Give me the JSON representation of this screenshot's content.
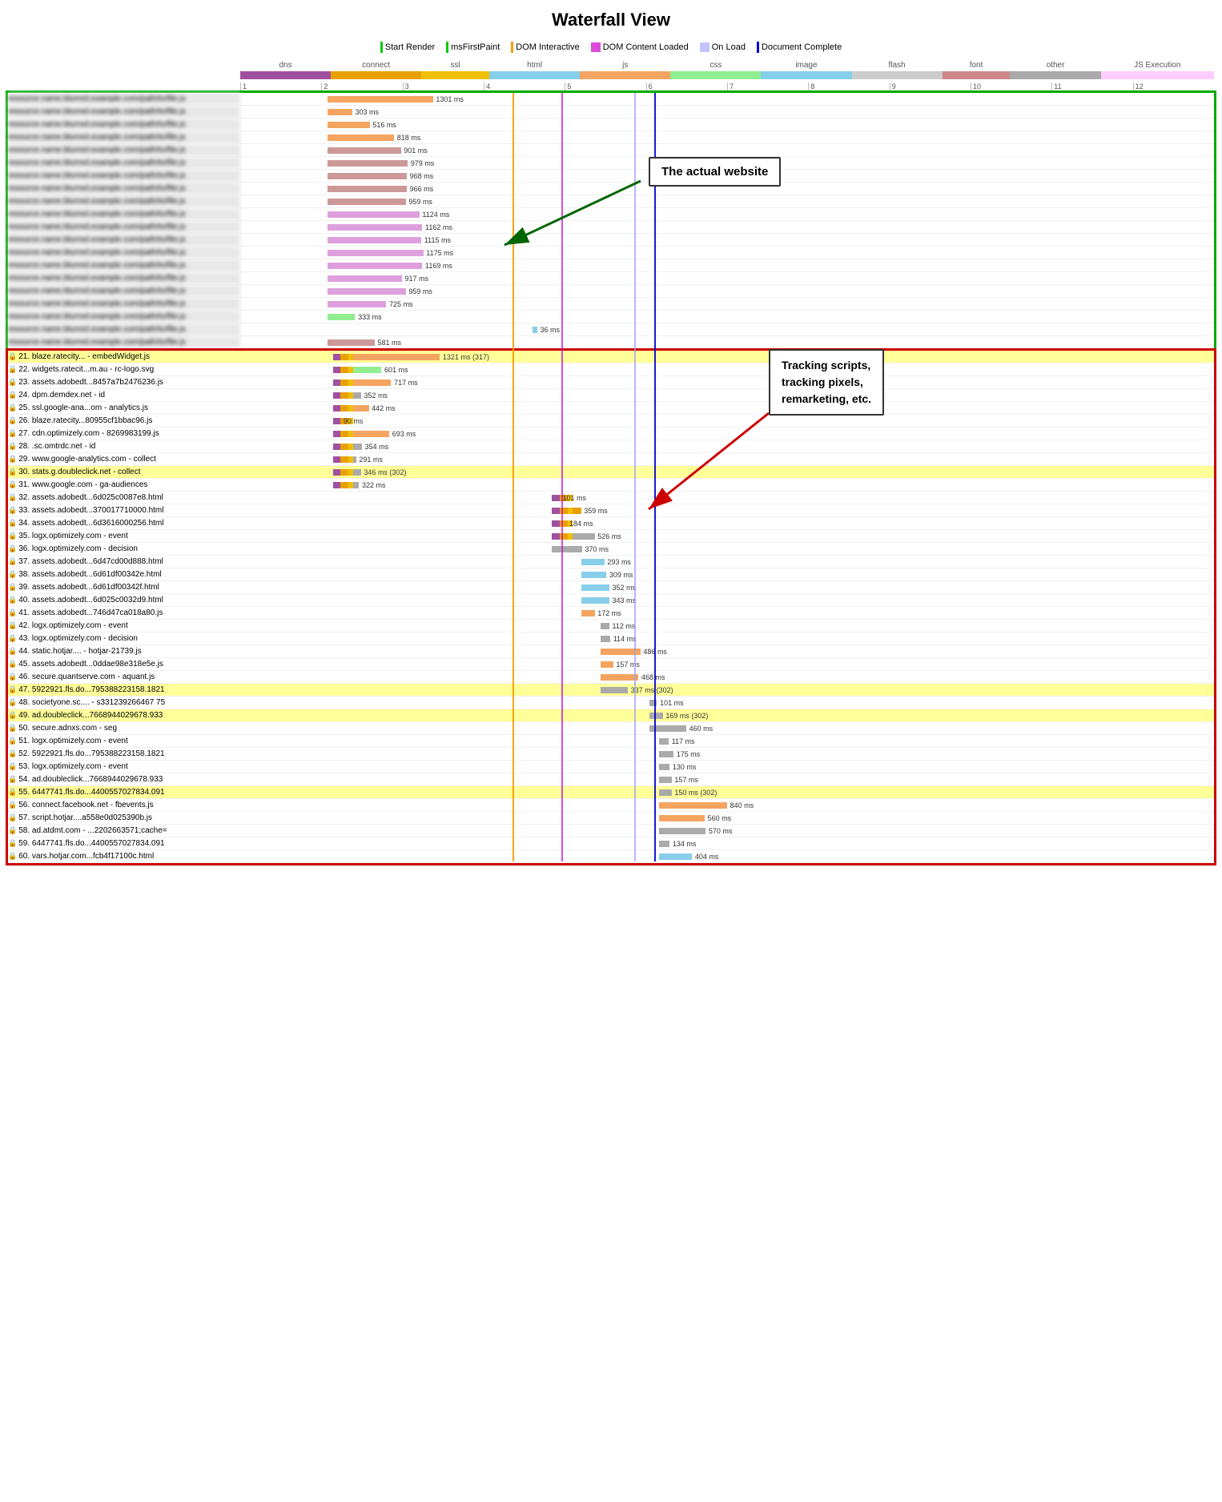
{
  "title": "Waterfall View",
  "legend": {
    "items": [
      {
        "label": "Start Render",
        "type": "line-green"
      },
      {
        "label": "msFirstPaint",
        "type": "line-green"
      },
      {
        "label": "DOM Interactive",
        "type": "line-orange"
      },
      {
        "label": "DOM Content Loaded",
        "type": "box-purple"
      },
      {
        "label": "On Load",
        "type": "box-lightblue"
      },
      {
        "label": "Document Complete",
        "type": "line-blue"
      }
    ]
  },
  "type_labels": [
    "dns",
    "connect",
    "ssl",
    "html",
    "js",
    "css",
    "image",
    "flash",
    "font",
    "other",
    "JS Execution"
  ],
  "type_colors": [
    "#a050a0",
    "#e8a000",
    "#f0c000",
    "#87ceeb",
    "#f4a460",
    "#90ee90",
    "#87ceeb",
    "#cccccc",
    "#cc8888",
    "#aaaaaa",
    "#ffccff"
  ],
  "tick_labels": [
    "1",
    "2",
    "3",
    "4",
    "5",
    "6",
    "7",
    "8",
    "9",
    "10",
    "11",
    "12"
  ],
  "annotations": {
    "actual_website": "The actual website",
    "tracking": "Tracking scripts,\ntracking pixels,\nremarketing, etc."
  },
  "rows": [
    {
      "name": "",
      "highlight": "none",
      "ms": "1301 ms",
      "type": "js"
    },
    {
      "name": "",
      "highlight": "none",
      "ms": "303 ms",
      "type": "js"
    },
    {
      "name": "",
      "highlight": "none",
      "ms": "516 ms",
      "type": "js"
    },
    {
      "name": "",
      "highlight": "none",
      "ms": "818 ms",
      "type": "js"
    },
    {
      "name": "",
      "highlight": "none",
      "ms": "901 ms",
      "type": "js"
    },
    {
      "name": "",
      "highlight": "none",
      "ms": "979 ms",
      "type": "js"
    },
    {
      "name": "",
      "highlight": "none",
      "ms": "968 ms",
      "type": "js"
    },
    {
      "name": "",
      "highlight": "none",
      "ms": "966 ms",
      "type": "js"
    },
    {
      "name": "",
      "highlight": "none",
      "ms": "959 ms",
      "type": "js"
    },
    {
      "name": "",
      "highlight": "none",
      "ms": "1124 ms",
      "type": "js"
    },
    {
      "name": "",
      "highlight": "none",
      "ms": "1162 ms",
      "type": "js"
    },
    {
      "name": "",
      "highlight": "none",
      "ms": "1115 ms",
      "type": "js"
    },
    {
      "name": "",
      "highlight": "none",
      "ms": "1175 ms",
      "type": "js"
    },
    {
      "name": "",
      "highlight": "none",
      "ms": "1169 ms",
      "type": "js"
    },
    {
      "name": "",
      "highlight": "none",
      "ms": "917 ms",
      "type": "js"
    },
    {
      "name": "",
      "highlight": "none",
      "ms": "959 ms",
      "type": "js"
    },
    {
      "name": "",
      "highlight": "none",
      "ms": "725 ms",
      "type": "js"
    },
    {
      "name": "",
      "highlight": "none",
      "ms": "333 ms",
      "type": "css"
    },
    {
      "name": "",
      "highlight": "none",
      "ms": "36 ms",
      "type": "image"
    },
    {
      "name": "",
      "highlight": "none",
      "ms": "581 ms",
      "type": "other"
    },
    {
      "name": "21. blaze.ratecity... - embedWidget.js",
      "highlight": "yellow",
      "ms": "1321 ms (317)",
      "type": "js"
    },
    {
      "name": "22. widgets.ratecit...m.au - rc-logo.svg",
      "highlight": "none",
      "ms": "601 ms",
      "type": "image"
    },
    {
      "name": "23. assets.adobedt...8457a7b2476236.js",
      "highlight": "none",
      "ms": "717 ms",
      "type": "js"
    },
    {
      "name": "24. dpm.demdex.net - id",
      "highlight": "none",
      "ms": "352 ms",
      "type": "other"
    },
    {
      "name": "25. ssl.google-ana...om - analytics.js",
      "highlight": "none",
      "ms": "442 ms",
      "type": "js"
    },
    {
      "name": "26. blaze.ratecity...80955cf1bbac96.js",
      "highlight": "none",
      "ms": "90 ms",
      "type": "js"
    },
    {
      "name": "27. cdn.optimizely.com - 8269983199.js",
      "highlight": "none",
      "ms": "693 ms",
      "type": "js"
    },
    {
      "name": "28.      .sc.omtrdc.net - id",
      "highlight": "none",
      "ms": "354 ms",
      "type": "other"
    },
    {
      "name": "29. www.google-analytics.com - collect",
      "highlight": "none",
      "ms": "291 ms",
      "type": "other"
    },
    {
      "name": "30. stats.g.doubleclick.net - collect",
      "highlight": "yellow2",
      "ms": "346 ms (302)",
      "type": "other"
    },
    {
      "name": "31. www.google.com - ga-audiences",
      "highlight": "none",
      "ms": "322 ms",
      "type": "other"
    },
    {
      "name": "32. assets.adobedt...6d025c0087e8.html",
      "highlight": "none",
      "ms": "101 ms",
      "type": "html"
    },
    {
      "name": "33. assets.adobedt...370017710000.html",
      "highlight": "none",
      "ms": "359 ms",
      "type": "html"
    },
    {
      "name": "34. assets.adobedt...6d3616000256.html",
      "highlight": "none",
      "ms": "184 ms",
      "type": "html"
    },
    {
      "name": "35. logx.optimizely.com - event",
      "highlight": "none",
      "ms": "526 ms",
      "type": "other"
    },
    {
      "name": "36. logx.optimizely.com - decision",
      "highlight": "none",
      "ms": "370 ms",
      "type": "other"
    },
    {
      "name": "37. assets.adobedt...6d47cd00d888.html",
      "highlight": "none",
      "ms": "293 ms",
      "type": "html"
    },
    {
      "name": "38. assets.adobedt...6d61df00342e.html",
      "highlight": "none",
      "ms": "309 ms",
      "type": "html"
    },
    {
      "name": "39. assets.adobedt...6d61df00342f.html",
      "highlight": "none",
      "ms": "352 ms",
      "type": "html"
    },
    {
      "name": "40. assets.adobedt...6d025c0032d9.html",
      "highlight": "none",
      "ms": "343 ms",
      "type": "html"
    },
    {
      "name": "41. assets.adobedt...746d47ca018a80.js",
      "highlight": "none",
      "ms": "172 ms",
      "type": "js"
    },
    {
      "name": "42. logx.optimizely.com - event",
      "highlight": "none",
      "ms": "112 ms",
      "type": "other"
    },
    {
      "name": "43. logx.optimizely.com - decision",
      "highlight": "none",
      "ms": "114 ms",
      "type": "other"
    },
    {
      "name": "44. static.hotjar.... - hotjar-21739.js",
      "highlight": "none",
      "ms": "486 ms",
      "type": "js"
    },
    {
      "name": "45. assets.adobedt...0ddae98e318e5e.js",
      "highlight": "none",
      "ms": "157 ms",
      "type": "js"
    },
    {
      "name": "46. secure.quantserve.com - aquant.js",
      "highlight": "none",
      "ms": "468 ms",
      "type": "js"
    },
    {
      "name": "47. 5922921.fls.do...795388223158.1821",
      "highlight": "yellow2",
      "ms": "337 ms (302)",
      "type": "other"
    },
    {
      "name": "48. societyone.sc.... - s331239266467 75",
      "highlight": "none",
      "ms": "101 ms",
      "type": "other"
    },
    {
      "name": "49. ad.doubleclick...7668944029678.933",
      "highlight": "yellow2",
      "ms": "169 ms (302)",
      "type": "other"
    },
    {
      "name": "50. secure.adnxs.com - seg",
      "highlight": "none",
      "ms": "460 ms",
      "type": "other"
    },
    {
      "name": "51. logx.optimizely.com - event",
      "highlight": "none",
      "ms": "117 ms",
      "type": "other"
    },
    {
      "name": "52. 5922921.fls.do...795388223158.1821",
      "highlight": "none",
      "ms": "175 ms",
      "type": "other"
    },
    {
      "name": "53. logx.optimizely.com - event",
      "highlight": "none",
      "ms": "130 ms",
      "type": "other"
    },
    {
      "name": "54. ad.doubleclick...7668944029678.933",
      "highlight": "none",
      "ms": "157 ms",
      "type": "other"
    },
    {
      "name": "55. 6447741.fls.do...4400557027834.091",
      "highlight": "yellow2",
      "ms": "150 ms (302)",
      "type": "other"
    },
    {
      "name": "56. connect.facebook.net - fbevents.js",
      "highlight": "none",
      "ms": "840 ms",
      "type": "js"
    },
    {
      "name": "57. script.hotjar....a558e0d025390b.js",
      "highlight": "none",
      "ms": "560 ms",
      "type": "js"
    },
    {
      "name": "58. ad.atdmt.com - ...2202663571;cache=",
      "highlight": "none",
      "ms": "570 ms",
      "type": "other"
    },
    {
      "name": "59. 6447741.fls.do...4400557027834.091",
      "highlight": "none",
      "ms": "134 ms",
      "type": "other"
    },
    {
      "name": "60. vars.hotjar.com...fcb4f17100c.html",
      "highlight": "none",
      "ms": "404 ms",
      "type": "html"
    }
  ],
  "vlines": {
    "orange": 28,
    "purple": 33,
    "lightblue": 40,
    "darkblue": 42
  }
}
